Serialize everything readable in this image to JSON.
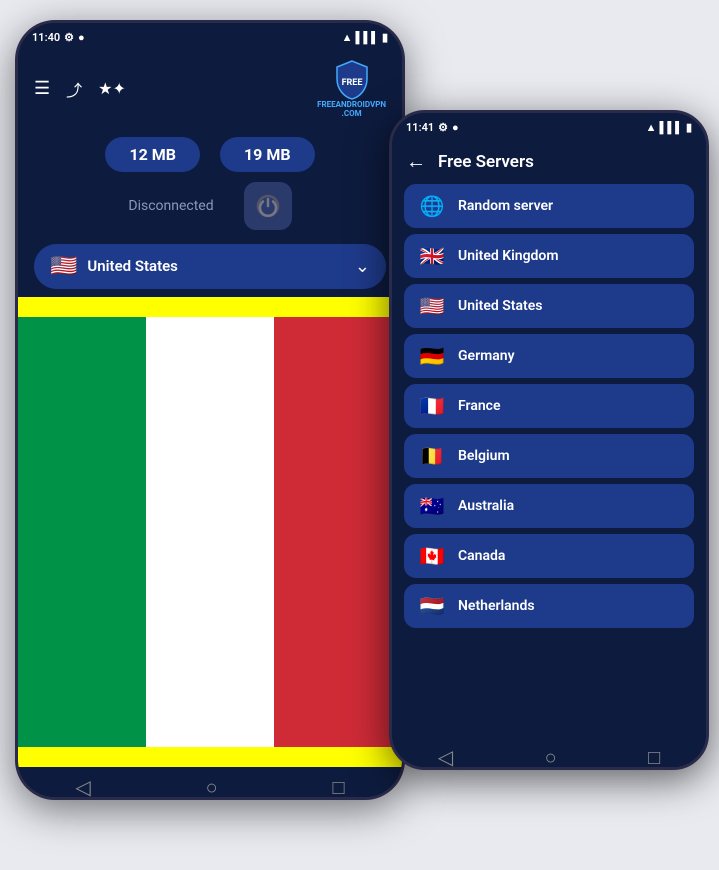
{
  "phone1": {
    "statusBar": {
      "time": "11:40",
      "settingsIcon": "⚙",
      "wifiIcon": "▲",
      "signalIcon": "▌▌▌",
      "batteryIcon": "▮"
    },
    "toolbar": {
      "menuIcon": "☰",
      "shareIcon": "⤴",
      "ratingIcon": "★",
      "logoLine1": "FREEANDROIDVPN",
      "logoLine2": ".COM"
    },
    "dataStats": {
      "upload": "12 MB",
      "download": "19 MB"
    },
    "connectionStatus": "Disconnected",
    "country": {
      "flag": "🇺🇸",
      "name": "United States"
    },
    "bottomNav": {
      "backLabel": "◁",
      "homeLabel": "○",
      "recentLabel": "□"
    }
  },
  "phone2": {
    "statusBar": {
      "time": "11:41",
      "settingsIcon": "⚙",
      "wifiIcon": "▲",
      "signalIcon": "▌▌▌",
      "batteryIcon": "▮"
    },
    "header": {
      "backArrow": "←",
      "title": "Free Servers"
    },
    "servers": [
      {
        "id": "random",
        "flag": "🌐",
        "name": "Random server"
      },
      {
        "id": "uk",
        "flag": "🇬🇧",
        "name": "United Kingdom"
      },
      {
        "id": "us",
        "flag": "🇺🇸",
        "name": "United States"
      },
      {
        "id": "de",
        "flag": "🇩🇪",
        "name": "Germany"
      },
      {
        "id": "fr",
        "flag": "🇫🇷",
        "name": "France"
      },
      {
        "id": "be",
        "flag": "🇧🇪",
        "name": "Belgium"
      },
      {
        "id": "au",
        "flag": "🇦🇺",
        "name": "Australia"
      },
      {
        "id": "ca",
        "flag": "🇨🇦",
        "name": "Canada"
      },
      {
        "id": "nl",
        "flag": "🇳🇱",
        "name": "Netherlands"
      }
    ],
    "bottomNav": {
      "backLabel": "◁",
      "homeLabel": "○",
      "recentLabel": "□"
    }
  }
}
